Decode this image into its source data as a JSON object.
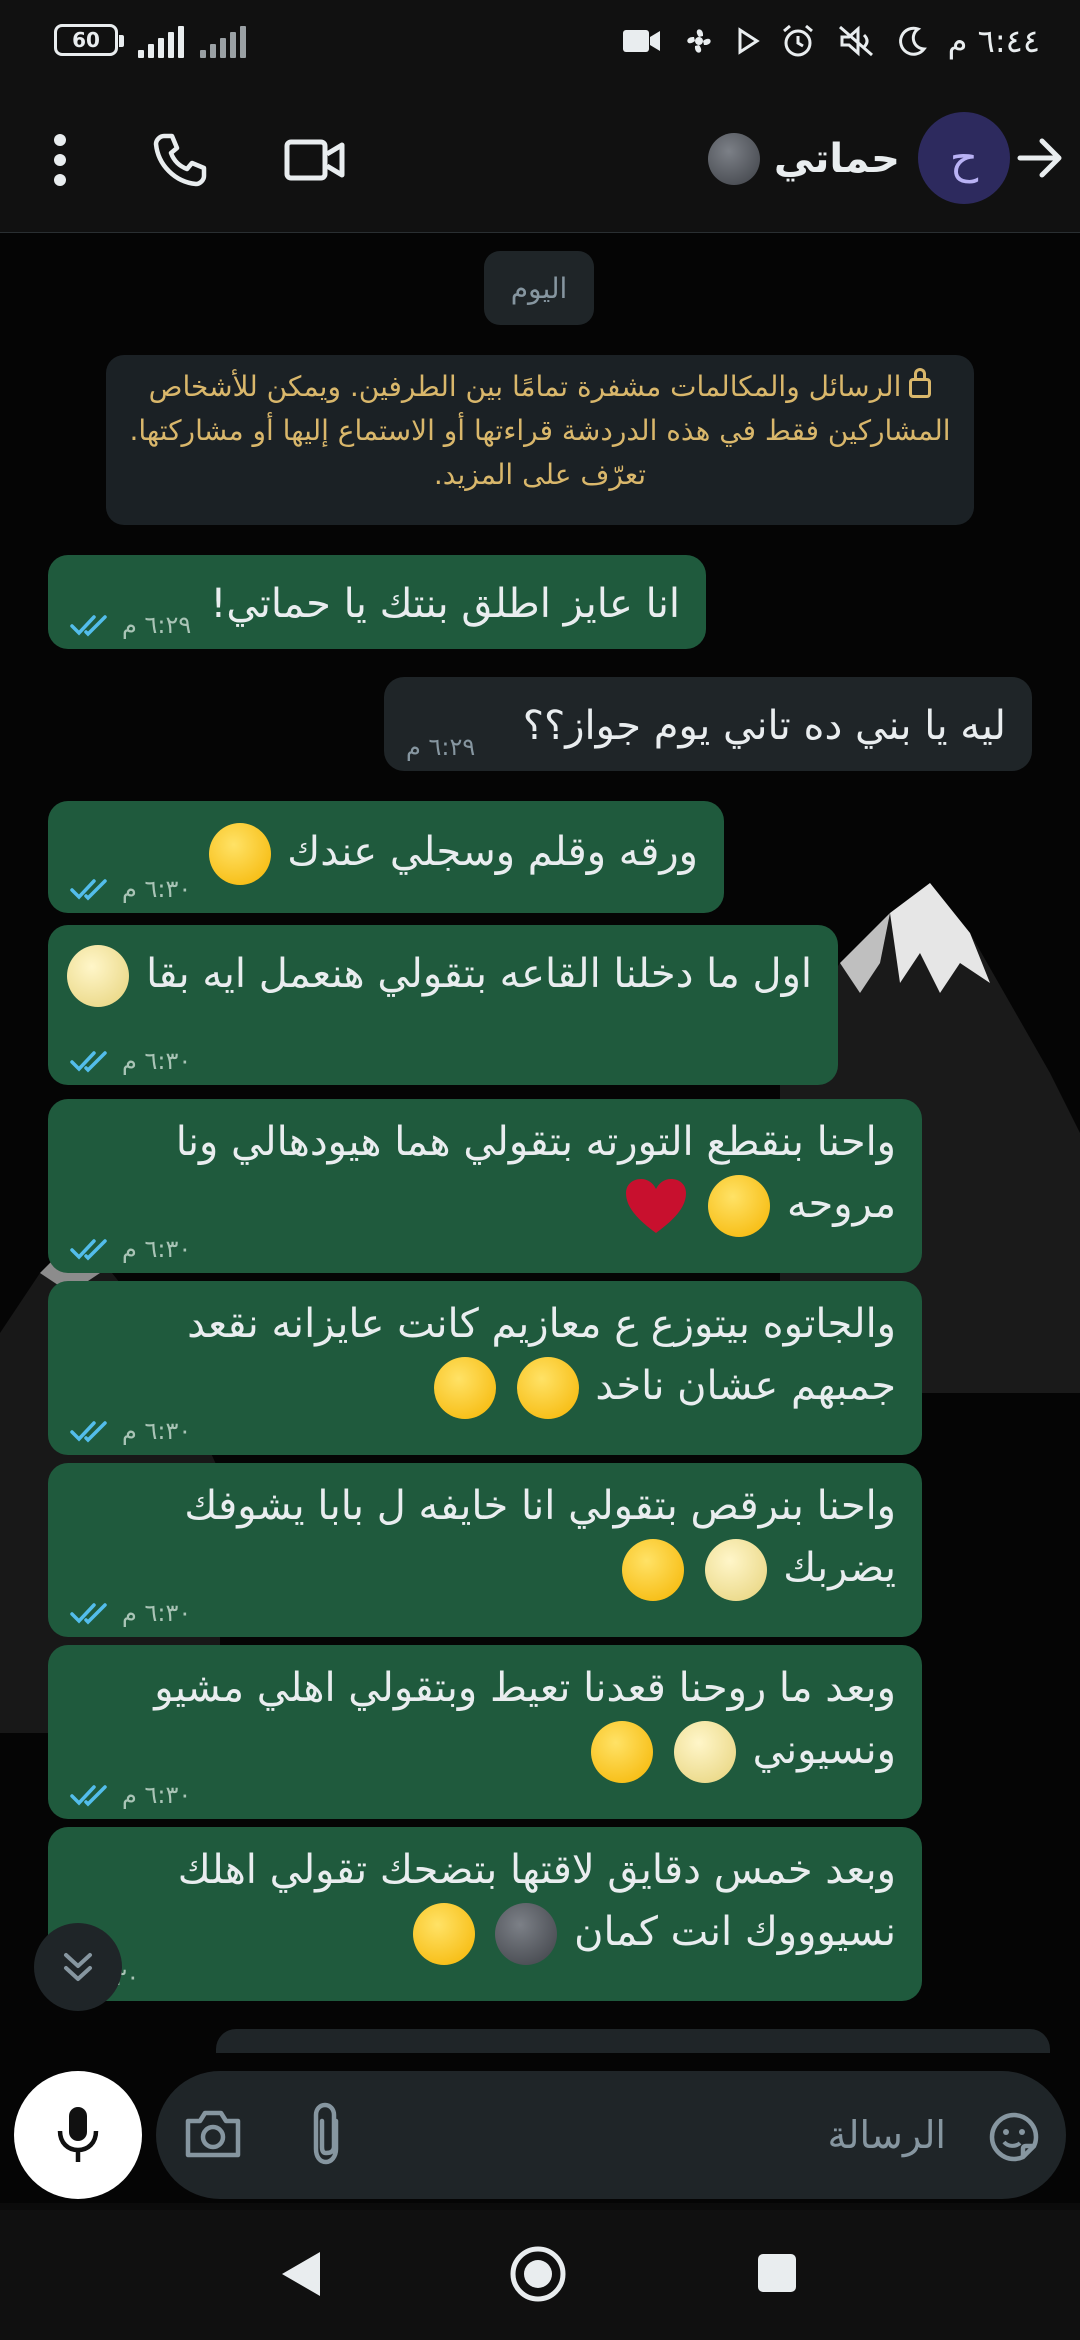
{
  "status_bar": {
    "battery": "60",
    "time": "٦:٤٤ م"
  },
  "header": {
    "contact_name": "حماتي",
    "avatar_letter": "ح",
    "icons": [
      "back-arrow-icon",
      "video-call-icon",
      "phone-icon",
      "more-icon"
    ]
  },
  "chat": {
    "date_chip": "اليوم",
    "encryption_notice": "الرسائل والمكالمات مشفرة تمامًا بين الطرفين. ويمكن للأشخاص المشاركين فقط في هذه الدردشة قراءتها أو الاستماع إليها أو مشاركتها. تعرّف على المزيد.",
    "messages": [
      {
        "direction": "out",
        "text": "انا عايز اطلق بنتك يا حماتي!",
        "time": "٦:٢٩ م",
        "ticks": "read"
      },
      {
        "direction": "in",
        "text": "ليه يا بني ده تاني يوم جواز؟؟",
        "time": "٦:٢٩ م"
      },
      {
        "direction": "out",
        "text": "ورقه وقلم وسجلي عندك",
        "emojis": [
          "slightly-smiling-face"
        ],
        "time": "٦:٣٠ م",
        "ticks": "read"
      },
      {
        "direction": "out",
        "text": "اول ما دخلنا القاعه بتقولي هنعمل ايه بقا",
        "emojis": [
          "full-moon-face"
        ],
        "time": "٦:٣٠ م",
        "ticks": "read"
      },
      {
        "direction": "out",
        "line1": "واحنا بنقطع التورته بتقولي هما هيودهالي ونا",
        "line2": "مروحه",
        "emojis": [
          "slightly-smiling-face",
          "red-heart"
        ],
        "time": "٦:٣٠ م",
        "ticks": "read"
      },
      {
        "direction": "out",
        "line1": "والجاتوه بيتوزع ع معازيم كانت عايزانه نقعد",
        "line2": "جمبهم عشان ناخد",
        "emojis": [
          "thinking-face",
          "slightly-smiling-face"
        ],
        "time": "٦:٣٠ م",
        "ticks": "read"
      },
      {
        "direction": "out",
        "line1": "واحنا بنرقص بتقولي انا خايفه ل بابا يشوفك",
        "line2": "يضربك",
        "emojis": [
          "full-moon-face",
          "face-with-tears-of-joy"
        ],
        "time": "٦:٣٠ م",
        "ticks": "read"
      },
      {
        "direction": "out",
        "line1": "وبعد ما روحنا قعدنا تعيط وبتقولي اهلي مشيو",
        "line2": "ونسيوني",
        "emojis": [
          "full-moon-face",
          "thinking-face"
        ],
        "time": "٦:٣٠ م",
        "ticks": "read"
      },
      {
        "direction": "out",
        "line1": "وبعد خمس دقايق لاقتها بتضحك تقولي اهلك",
        "line2": "نسيوووك انت كمان",
        "emojis": [
          "new-moon-face",
          "face-with-tears-of-joy"
        ],
        "time": "٦:٣٠ م"
      }
    ]
  },
  "input": {
    "placeholder": "الرسالة"
  },
  "colors": {
    "outgoing_bubble": "#1f5a3d",
    "incoming_bubble": "#1f2528",
    "read_ticks": "#53bdeb",
    "notice_text": "#d9b76b"
  }
}
